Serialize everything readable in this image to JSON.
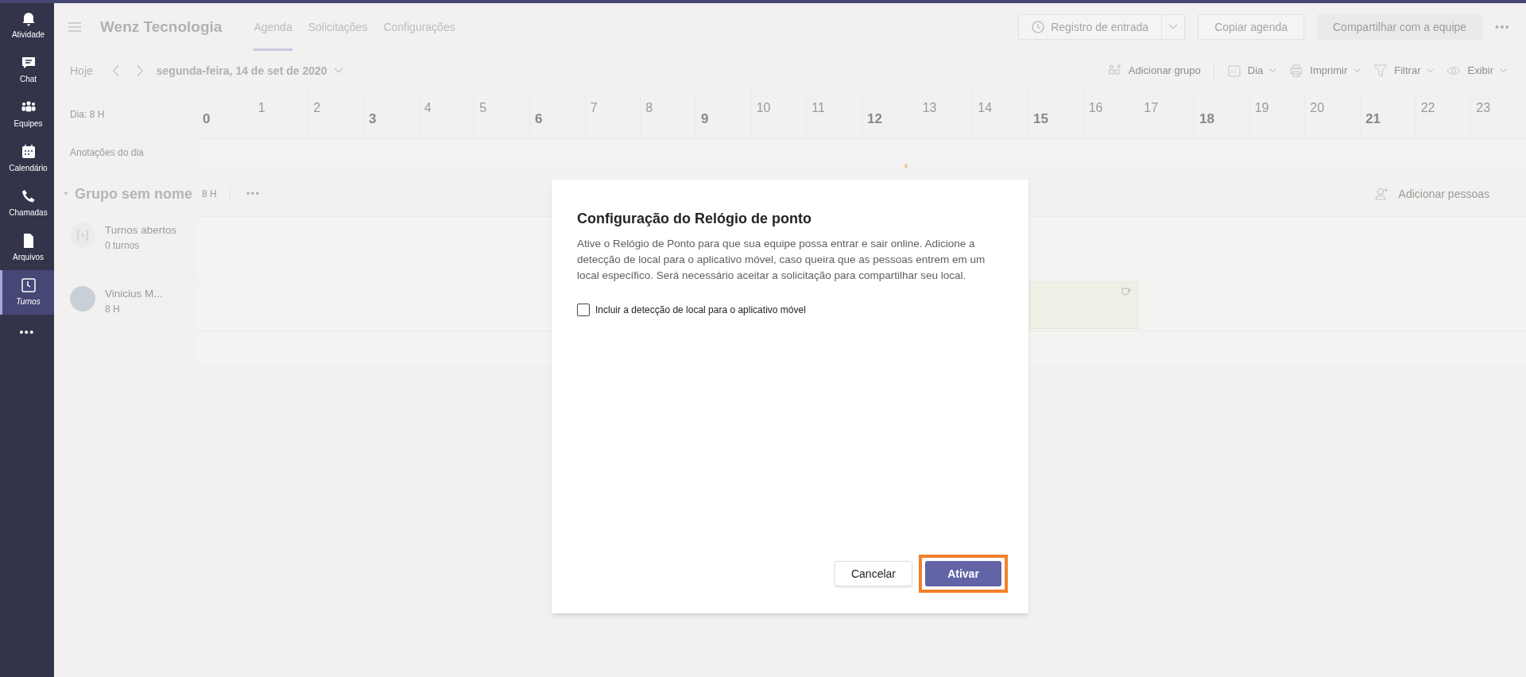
{
  "sidebar": {
    "items": [
      {
        "kind": "bell",
        "label": "Atividade",
        "selected": false
      },
      {
        "kind": "chat",
        "label": "Chat",
        "selected": false
      },
      {
        "kind": "teams",
        "label": "Equipes",
        "selected": false
      },
      {
        "kind": "calendar",
        "label": "Calendário",
        "selected": false
      },
      {
        "kind": "phone",
        "label": "Chamadas",
        "selected": false
      },
      {
        "kind": "file",
        "label": "Arquivos",
        "selected": false
      },
      {
        "kind": "clock",
        "label": "Turnos",
        "selected": true
      }
    ],
    "more": "•••"
  },
  "header": {
    "team": "Wenz Tecnologia",
    "tabs": [
      {
        "label": "Agenda",
        "selected": true
      },
      {
        "label": "Solicitações",
        "selected": false
      },
      {
        "label": "Configurações",
        "selected": false
      }
    ],
    "clock_in": "Registro de entrada",
    "copy": "Copiar agenda",
    "share": {
      "label": "Compartilhar com a equipe",
      "disabled": true
    },
    "more": "•••"
  },
  "toolbar": {
    "today": "Hoje",
    "date": "segunda-feira, 14 de set de 2020",
    "actions": [
      {
        "kind": "add-group",
        "label": "Adicionar grupo",
        "dropdown": false
      },
      {
        "kind": "day",
        "label": "Dia",
        "dropdown": true
      },
      {
        "kind": "print",
        "label": "Imprimir",
        "dropdown": true
      },
      {
        "kind": "filter",
        "label": "Filtrar",
        "dropdown": true
      },
      {
        "kind": "view",
        "label": "Exibir",
        "dropdown": true
      }
    ]
  },
  "timeline": {
    "day_total": "Dia: 8 H",
    "notes_label": "Anotações do dia",
    "hours": [
      {
        "label": "0",
        "major": true
      },
      {
        "label": "1",
        "major": false
      },
      {
        "label": "2",
        "major": false
      },
      {
        "label": "3",
        "major": true
      },
      {
        "label": "4",
        "major": false
      },
      {
        "label": "5",
        "major": false
      },
      {
        "label": "6",
        "major": true
      },
      {
        "label": "7",
        "major": false
      },
      {
        "label": "8",
        "major": false
      },
      {
        "label": "9",
        "major": true
      },
      {
        "label": "10",
        "major": false
      },
      {
        "label": "11",
        "major": false
      },
      {
        "label": "12",
        "major": true
      },
      {
        "label": "13",
        "major": false
      },
      {
        "label": "14",
        "major": false
      },
      {
        "label": "15",
        "major": true
      },
      {
        "label": "16",
        "major": false
      },
      {
        "label": "17",
        "major": false
      },
      {
        "label": "18",
        "major": true
      },
      {
        "label": "19",
        "major": false
      },
      {
        "label": "20",
        "major": false
      },
      {
        "label": "21",
        "major": true
      },
      {
        "label": "22",
        "major": false
      },
      {
        "label": "23",
        "major": false
      }
    ]
  },
  "group": {
    "name": "Grupo sem nome",
    "hours": "8 H",
    "more": "•••",
    "add_people": "Adicionar pessoas",
    "rows": [
      {
        "kind": "open",
        "name": "Turnos abertos",
        "detail": "0 turnos"
      },
      {
        "kind": "member",
        "name": "Vinicius M...",
        "detail": "8 H"
      }
    ]
  },
  "dialog": {
    "title": "Configuração do Relógio de ponto",
    "text": "Ative o Relógio de Ponto para que sua equipe possa entrar e sair online. Adicione a detecção de local para o aplicativo móvel, caso queira que as pessoas entrem em um local específico. Será necessário aceitar a solicitação para compartilhar seu local.",
    "checkbox": {
      "label": "Incluir a detecção de local para o aplicativo móvel",
      "checked": false
    },
    "cancel": "Cancelar",
    "confirm": {
      "label": "Ativar",
      "highlighted": true
    }
  }
}
